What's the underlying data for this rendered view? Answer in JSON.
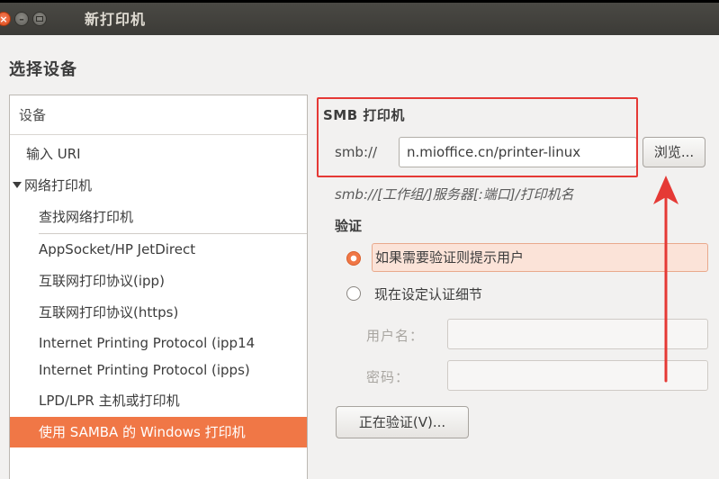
{
  "window": {
    "title": "新打印机",
    "close_icon": "close-icon",
    "minimize_icon": "minimize-icon",
    "maximize_icon": "maximize-icon"
  },
  "heading": "选择设备",
  "device_list": {
    "header": "设备",
    "items": [
      "输入 URI",
      "网络打印机",
      "查找网络打印机",
      "AppSocket/HP JetDirect",
      "互联网打印协议(ipp)",
      "互联网打印协议(https)",
      "Internet Printing Protocol (ipp14",
      "Internet Printing Protocol (ipps)",
      "LPD/LPR 主机或打印机",
      "使用 SAMBA 的 Windows 打印机"
    ],
    "selected_item": "使用 SAMBA 的 Windows 打印机"
  },
  "smb": {
    "title": "SMB 打印机",
    "label": "smb://",
    "value": "n.mioffice.cn/printer-linux",
    "browse_button": "浏览...",
    "hint": "smb://[工作组/]服务器[:端口]/打印机名"
  },
  "auth": {
    "title": "验证",
    "option_prompt": "如果需要验证则提示用户",
    "option_now": "现在设定认证细节",
    "selected_option": "如果需要验证则提示用户",
    "username_label": "用户名：",
    "password_label": "密码：",
    "username_value": "",
    "password_value": "",
    "verify_button": "正在验证(V)..."
  },
  "annotation": {
    "color": "#e53935"
  },
  "colors": {
    "accent": "#f07746",
    "titlebar": "#3c3b37"
  }
}
